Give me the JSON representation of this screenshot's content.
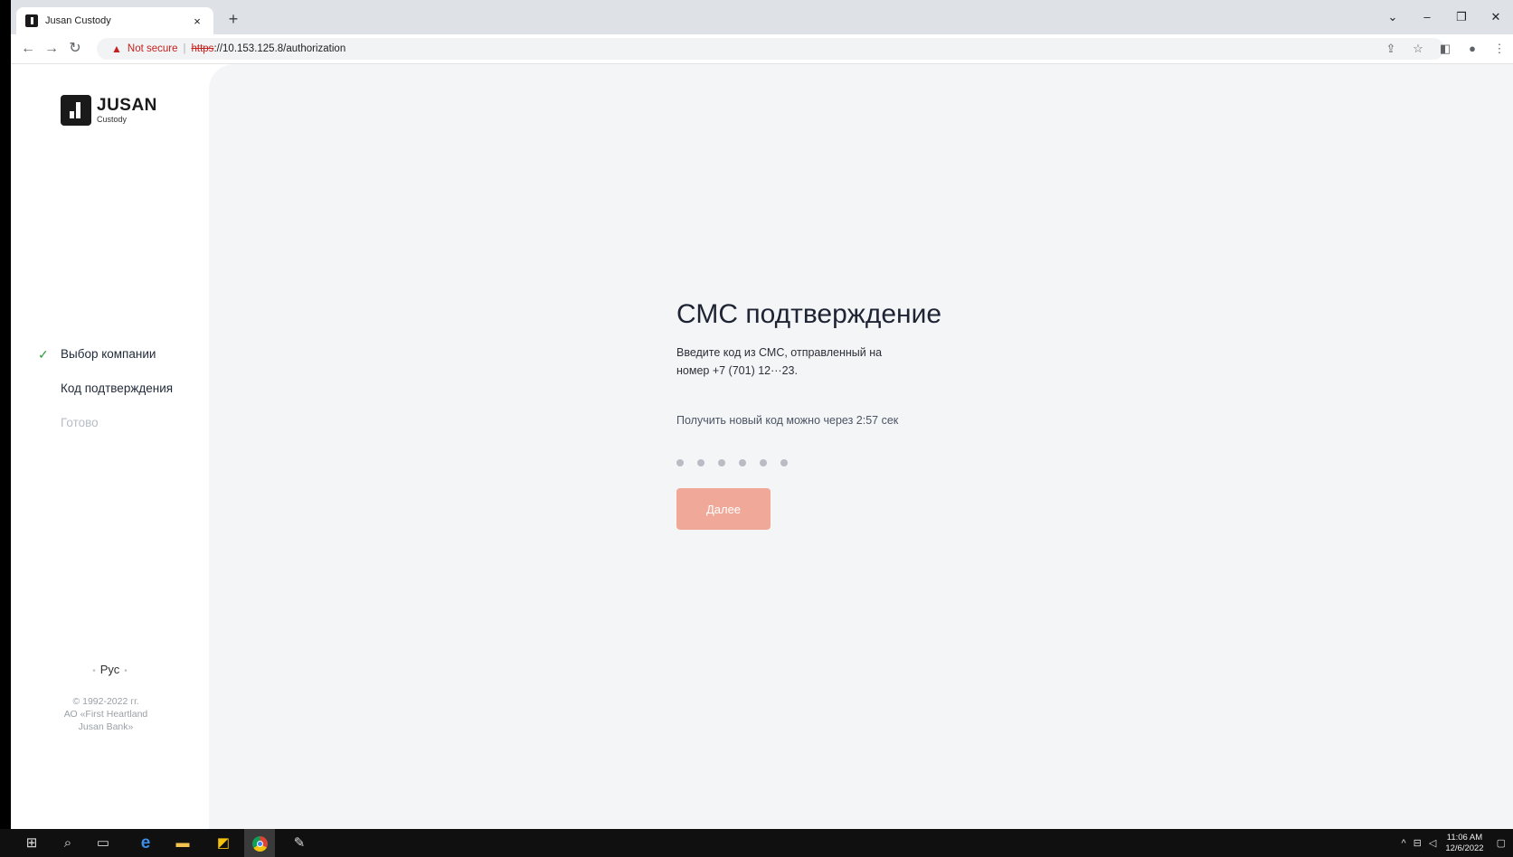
{
  "browser": {
    "tab_title": "Jusan Custody",
    "tab_close": "×",
    "new_tab": "+",
    "not_secure": "Not secure",
    "url_scheme": "https",
    "url_rest": "://10.153.125.8/authorization",
    "window_controls": {
      "minimize": "–",
      "restore": "❐",
      "close": "✕",
      "tab_search": "⌄"
    },
    "nav": {
      "back": "←",
      "forward": "→",
      "reload": "↻"
    },
    "toolbar_icons": {
      "share": "⇪",
      "bookmark": "☆",
      "side_panel": "◧",
      "profile": "●",
      "menu": "⋮"
    }
  },
  "sidebar": {
    "logo_title": "JUSAN",
    "logo_subtitle": "Custody",
    "steps": [
      {
        "label": "Выбор компании",
        "state": "done"
      },
      {
        "label": "Код подтверждения",
        "state": "active"
      },
      {
        "label": "Готово",
        "state": "pending"
      }
    ],
    "check_mark": "✓",
    "language": "Рус",
    "copyright_line1": "© 1992-2022 гг.",
    "copyright_line2": "АО «First Heartland",
    "copyright_line3": "Jusan Bank»"
  },
  "main": {
    "title": "СМС подтверждение",
    "description_line1": "Введите код из СМС, отправленный на",
    "description_line2": "номер +7 (701) 12···23.",
    "resend_text": "Получить новый код можно через 2:57 сек",
    "code_length": 6,
    "next_button": "Далее"
  },
  "taskbar": {
    "time": "11:06 AM",
    "date": "12/6/2022"
  },
  "colors": {
    "accent_button": "#f0a898",
    "check_green": "#2e9e3e",
    "main_bg": "#f4f5f7"
  }
}
